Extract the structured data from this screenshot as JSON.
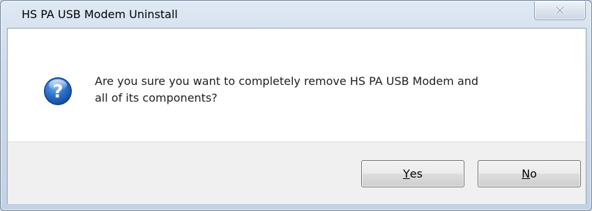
{
  "dialog": {
    "title": "HS PA USB Modem Uninstall",
    "message_line1": "Are you sure you want to completely remove HS PA USB Modem and",
    "message_line2": "all of its components?",
    "icon": "question-icon",
    "close_icon": "close-icon"
  },
  "buttons": {
    "yes": {
      "mnemonic": "Y",
      "rest": "es"
    },
    "no": {
      "mnemonic": "N",
      "rest": "o"
    }
  },
  "colors": {
    "question_icon_blue": "#2a6fc6",
    "button_area_bg": "#f0f0f0",
    "frame_glass": "#cfdceb"
  }
}
